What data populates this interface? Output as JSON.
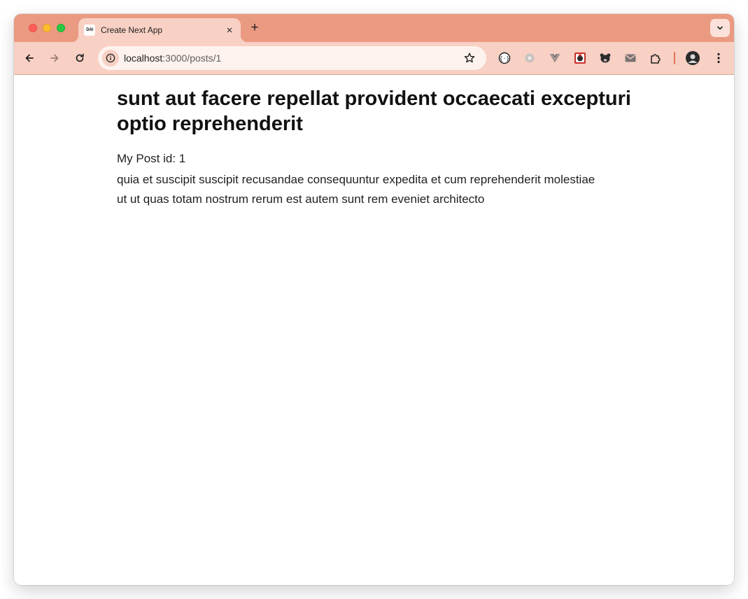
{
  "browser": {
    "tab": {
      "favicon_text": "DAI",
      "title": "Create Next App",
      "close_glyph": "×"
    },
    "new_tab_glyph": "+",
    "address_bar": {
      "host": "localhost",
      "path": ":3000/posts/1"
    },
    "colors": {
      "frame": "#eb9a82",
      "toolbar": "#f8d0c4",
      "omnibox": "#fdf2ee"
    }
  },
  "post": {
    "title": "sunt aut facere repellat provident occaecati excepturi optio reprehenderit",
    "id_label": "My Post id: 1",
    "body_line1": "quia et suscipit suscipit recusandae consequuntur expedita et cum reprehenderit molestiae",
    "body_line2": "ut ut quas totam nostrum rerum est autem sunt rem eveniet architecto"
  }
}
